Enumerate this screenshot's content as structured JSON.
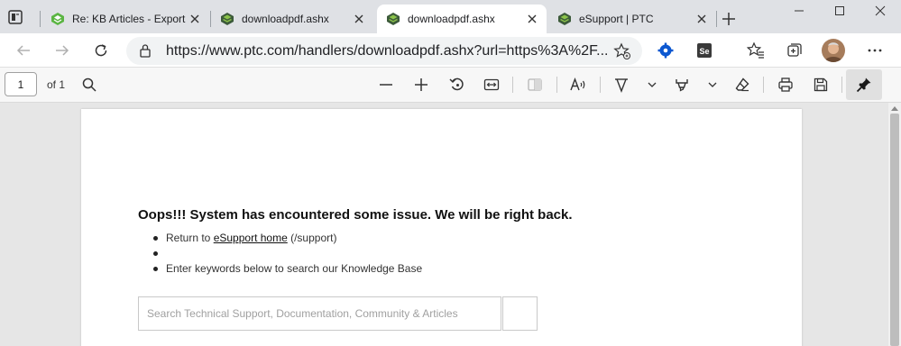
{
  "tabs": [
    {
      "title": "Re: KB Articles - Export",
      "favicon": "ptc-community-icon",
      "active": false
    },
    {
      "title": "downloadpdf.ashx",
      "favicon": "ptc-icon",
      "active": false
    },
    {
      "title": "downloadpdf.ashx",
      "favicon": "ptc-icon",
      "active": true
    },
    {
      "title": "eSupport | PTC",
      "favicon": "ptc-icon",
      "active": false
    }
  ],
  "address_bar": {
    "url": "https://www.ptc.com/handlers/downloadpdf.ashx?url=https%3A%2F..."
  },
  "pdf_toolbar": {
    "page_number": "1",
    "page_count": "of 1"
  },
  "content": {
    "error_title": "Oops!!! System has encountered some issue. We will be right back.",
    "bullet1_prefix": "Return to ",
    "bullet1_link": "eSupport home",
    "bullet1_suffix": " (/support)",
    "bullet2": "",
    "bullet3": "Enter keywords below to search our Knowledge Base",
    "search_placeholder": "Search Technical Support, Documentation, Community & Articles"
  },
  "colors": {
    "brand_green": "#5bb543",
    "brand_dark": "#3c5a3a",
    "settings_blue": "#0b57d0"
  }
}
